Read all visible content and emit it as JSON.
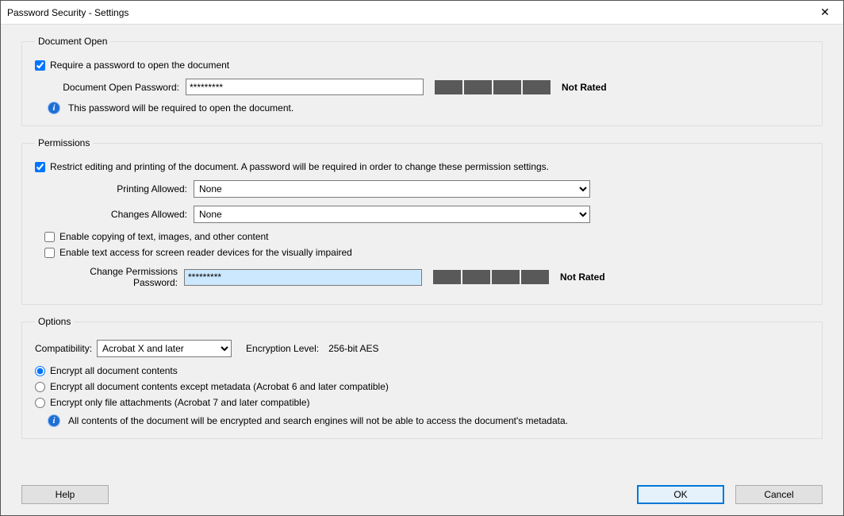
{
  "window": {
    "title": "Password Security - Settings"
  },
  "docopen": {
    "legend": "Document Open",
    "require_label": "Require a password to open the document",
    "password_label": "Document Open Password:",
    "password_value": "*********",
    "rating": "Not Rated",
    "info": "This password will be required to open the document."
  },
  "perms": {
    "legend": "Permissions",
    "restrict_label": "Restrict editing and printing of the document. A password will be required in order to change these permission settings.",
    "printing_label": "Printing Allowed:",
    "printing_value": "None",
    "changes_label": "Changes Allowed:",
    "changes_value": "None",
    "enable_copy_label": "Enable copying of text, images, and other content",
    "enable_reader_label": "Enable text access for screen reader devices for the visually impaired",
    "change_pw_label": "Change Permissions Password:",
    "change_pw_value": "*********",
    "rating": "Not Rated"
  },
  "options": {
    "legend": "Options",
    "compat_label": "Compatibility:",
    "compat_value": "Acrobat X and later",
    "enc_label": "Encryption Level:",
    "enc_value": "256-bit AES",
    "r1": "Encrypt all document contents",
    "r2": "Encrypt all document contents except metadata (Acrobat 6 and later compatible)",
    "r3": "Encrypt only file attachments (Acrobat 7 and later compatible)",
    "info": "All contents of the document will be encrypted and search engines will not be able to access the document's metadata."
  },
  "buttons": {
    "help": "Help",
    "ok": "OK",
    "cancel": "Cancel"
  }
}
